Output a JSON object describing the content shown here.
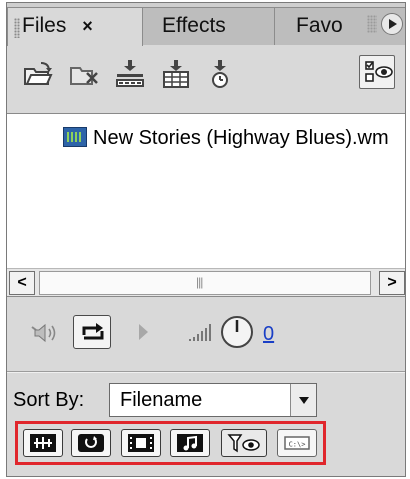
{
  "tabs": [
    {
      "label": "Files",
      "close": "×",
      "active": true
    },
    {
      "label": "Effects",
      "active": false
    },
    {
      "label": "Favo",
      "active": false
    }
  ],
  "toolbar": {
    "icons": [
      "open-folder-icon",
      "delete-file-icon",
      "import-icon",
      "export-icon",
      "timer-icon",
      "view-options-icon"
    ]
  },
  "list": {
    "items": [
      {
        "name": "New Stories (Highway Blues).wm",
        "icon": "video-file-icon"
      }
    ]
  },
  "playback": {
    "icons": [
      "speaker-icon",
      "loop-icon",
      "play-icon",
      "level-icon",
      "volume-knob-icon"
    ],
    "volume_value": "0"
  },
  "sort": {
    "label": "Sort By:",
    "selected": "Filename"
  },
  "filters": {
    "icons": [
      "audio-filter-icon",
      "transition-filter-icon",
      "video-filter-icon",
      "music-filter-icon",
      "view-filter-icon",
      "path-filter-icon"
    ]
  },
  "colors": {
    "panel": "#d9d9d9",
    "highlight_border": "#e0262c",
    "link": "#1a3fc6"
  }
}
